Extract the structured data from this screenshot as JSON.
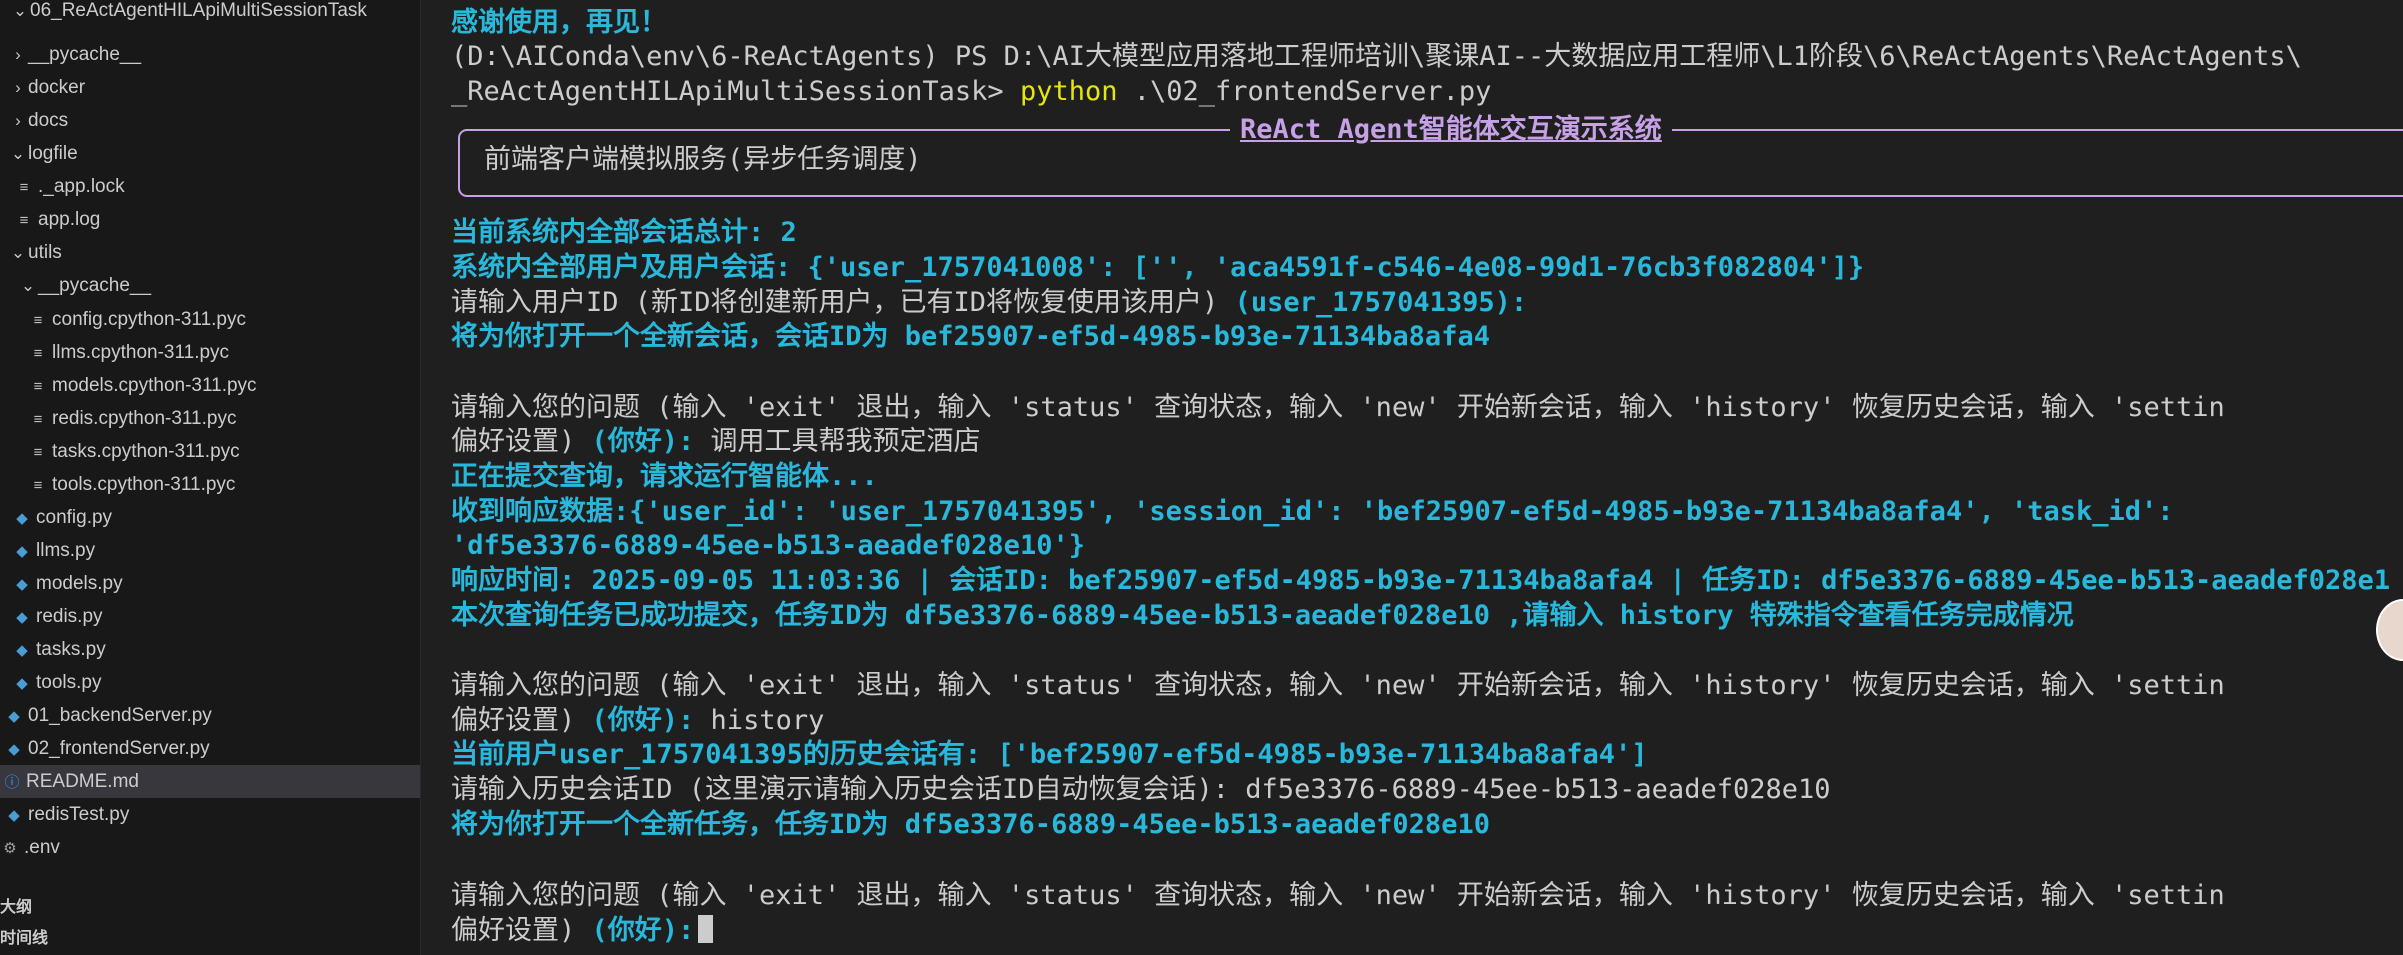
{
  "explorer": {
    "items": [
      {
        "label": "06_ReActAgentHILApiMultiSessionTask",
        "kind": "folder-open"
      },
      {
        "label": "__pycache__",
        "kind": "folder-closed"
      },
      {
        "label": "docker",
        "kind": "folder-closed"
      },
      {
        "label": "docs",
        "kind": "folder-closed"
      },
      {
        "label": "logfile",
        "kind": "folder-open"
      },
      {
        "label": "._app.lock",
        "kind": "file"
      },
      {
        "label": "app.log",
        "kind": "file"
      },
      {
        "label": "utils",
        "kind": "folder-open"
      },
      {
        "label": "__pycache__",
        "kind": "folder-open"
      },
      {
        "label": "config.cpython-311.pyc",
        "kind": "file"
      },
      {
        "label": "llms.cpython-311.pyc",
        "kind": "file"
      },
      {
        "label": "models.cpython-311.pyc",
        "kind": "file"
      },
      {
        "label": "redis.cpython-311.pyc",
        "kind": "file"
      },
      {
        "label": "tasks.cpython-311.pyc",
        "kind": "file"
      },
      {
        "label": "tools.cpython-311.pyc",
        "kind": "file"
      },
      {
        "label": "config.py",
        "kind": "python"
      },
      {
        "label": "llms.py",
        "kind": "python"
      },
      {
        "label": "models.py",
        "kind": "python"
      },
      {
        "label": "redis.py",
        "kind": "python"
      },
      {
        "label": "tasks.py",
        "kind": "python"
      },
      {
        "label": "tools.py",
        "kind": "python"
      },
      {
        "label": "01_backendServer.py",
        "kind": "python"
      },
      {
        "label": "02_frontendServer.py",
        "kind": "python"
      },
      {
        "label": "README.md",
        "kind": "info"
      },
      {
        "label": "redisTest.py",
        "kind": "python"
      },
      {
        "label": ".env",
        "kind": "gear"
      }
    ],
    "outline_label": "大纲",
    "timeline_label": "时间线"
  },
  "terminal": {
    "line_goodbye": "感谢使用，再见！",
    "prompt_line1": "(D:\\AIConda\\env\\6-ReActAgents) PS D:\\AI大模型应用落地工程师培训\\聚课AI--大数据应用工程师\\L1阶段\\6\\ReActAgents\\ReActAgents\\",
    "prompt_line2_path": "_ReActAgentHILApiMultiSessionTask>",
    "prompt_line2_cmd": "python",
    "prompt_line2_arg": ".\\02_frontendServer.py",
    "panel_title": "ReAct Agent智能体交互演示系统",
    "panel_text": "前端客户端模拟服务(异步任务调度)",
    "session_total": "当前系统内全部会话总计: 2",
    "all_sessions": "系统内全部用户及用户会话: {'user_1757041008': ['', 'aca4591f-c546-4e08-99d1-76cb3f082804']}",
    "ask_user_id": "请输入用户ID (新ID将创建新用户，已有ID将恢复使用该用户) ",
    "default_user": "(user_1757041395):",
    "open_session": "将为你打开一个全新会话，会话ID为 bef25907-ef5d-4985-b93e-71134ba8afa4",
    "question_prompt": "请输入您的问题 (输入 'exit' 退出，输入 'status' 查询状态，输入 'new' 开始新会话，输入 'history' 恢复历史会话，输入 'settin",
    "question_prompt_cont": "偏好设置) ",
    "default_question": "(你好):",
    "q1_answer": " 调用工具帮我预定酒店",
    "submitting": "正在提交查询，请求运行智能体...",
    "response_data": "收到响应数据:{'user_id': 'user_1757041395', 'session_id': 'bef25907-ef5d-4985-b93e-71134ba8afa4', 'task_id':",
    "response_data_cont": "'df5e3376-6889-45ee-b513-aeadef028e10'}",
    "response_time": "响应时间: 2025-09-05 11:03:36 | 会话ID: bef25907-ef5d-4985-b93e-71134ba8afa4 | 任务ID: df5e3376-6889-45ee-b513-aeadef028e1",
    "task_submitted": "本次查询任务已成功提交，任务ID为 df5e3376-6889-45ee-b513-aeadef028e10 ,请输入 history 特殊指令查看任务完成情况",
    "q2_answer": " history",
    "history_sessions": "当前用户user_1757041395的历史会话有: ['bef25907-ef5d-4985-b93e-71134ba8afa4']",
    "ask_history_id": "请输入历史会话ID (这里演示请输入历史会话ID自动恢复会话): df5e3376-6889-45ee-b513-aeadef028e10",
    "open_task": "将为你打开一个全新任务，任务ID为 df5e3376-6889-45ee-b513-aeadef028e10"
  }
}
